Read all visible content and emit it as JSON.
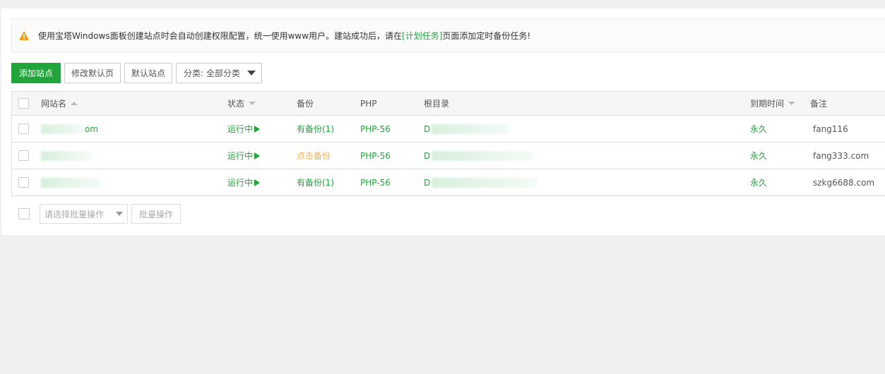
{
  "notice": {
    "text_before": "使用宝塔Windows面板创建站点时会自动创建权限配置，统一使用www用户。建站成功后，请在",
    "link": "[计划任务]",
    "text_after": "页面添加定时备份任务!"
  },
  "toolbar": {
    "add_site": "添加站点",
    "edit_default_page": "修改默认页",
    "default_site": "默认站点",
    "category_select": "分类: 全部分类"
  },
  "table": {
    "headers": {
      "site_name": "网站名",
      "status": "状态",
      "backup": "备份",
      "php": "PHP",
      "root_dir": "根目录",
      "expire": "到期时间",
      "note": "备注"
    },
    "rows": [
      {
        "site_suffix": "om",
        "status": "运行中",
        "backup": "有备份(1)",
        "php": "PHP-56",
        "root_prefix": "D",
        "expire": "永久",
        "note": "fang116"
      },
      {
        "site_suffix": "",
        "status": "运行中",
        "backup": "点击备份",
        "php": "PHP-56",
        "root_prefix": "D",
        "expire": "永久",
        "note": "fang333.com"
      },
      {
        "site_suffix": "",
        "status": "运行中",
        "backup": "有备份(1)",
        "php": "PHP-56",
        "root_prefix": "D",
        "expire": "永久",
        "note": "szkg6688.com"
      }
    ]
  },
  "footer": {
    "batch_placeholder": "请选择批量操作",
    "batch_button": "批量操作"
  },
  "colors": {
    "accent_green": "#20a53a",
    "warning_orange": "#f0ad4e"
  }
}
